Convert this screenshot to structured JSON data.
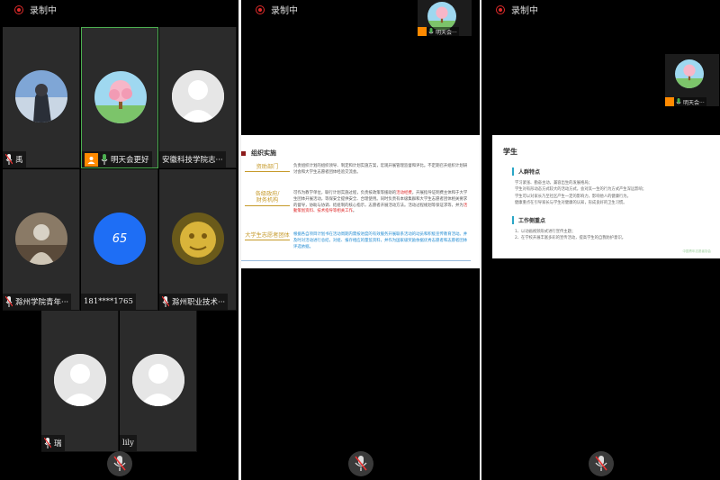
{
  "recording": {
    "label": "录制中"
  },
  "gallery": {
    "tiles": [
      {
        "name": "禹",
        "mic": "muted",
        "avatar": "photo-person"
      },
      {
        "name": "明天会更好",
        "mic": "active",
        "host": true,
        "avatar": "tree-illustration"
      },
      {
        "name": "安徽科技学院志···",
        "mic": "none",
        "avatar": "default"
      },
      {
        "name": "滁州学院青年···",
        "mic": "muted",
        "avatar": "photo-soldier"
      },
      {
        "name": "181****1765",
        "mic": "none",
        "avatar": "number",
        "avatar_text": "65"
      },
      {
        "name": "滁州职业技术···",
        "mic": "muted",
        "avatar": "golden-statue"
      },
      {
        "name": "瑞",
        "mic": "muted",
        "avatar": "default"
      },
      {
        "name": "lily",
        "mic": "none",
        "avatar": "default"
      }
    ]
  },
  "mini_video": {
    "label": "明天会···"
  },
  "slide_org": {
    "title": "组织实施",
    "rows": [
      {
        "key": "资助部门",
        "value": "负责组织计划的组织领导、制定和计划实施方案，宏观开展管理监督和评比。不定期召开组织计划研讨会和大学生志愿者团体经验交流会。"
      },
      {
        "key": "各级政府/\n财务机构",
        "value_a": "可作为教学单位，联行计划实施过程，负责按政策等援助的",
        "value_red": "活动经费",
        "value_b": "，开展指导证明费主体和于大学生团体开展活动，等保安全提供安全、合理使用。同时负责有本级集群和大学生志愿者团体相关要求的督导，协助与协调、结组制的核心指示，志愿者开展活动方法。活动过程规划等保证求等，并为",
        "value_red2": "活動策划资料、技术指导等相关工作",
        "value_c": "。"
      },
      {
        "key": "大学生志愿者团体",
        "value": "根据各自项目计划书在活动周期内需按进度的有效服务开展联系活动的动员和积极宣传教育活动。并及时对活动进行总结，对组、报存相应的量监资料，并作为国家级奖励依据优秀志愿者和志愿者团体评选依据。"
      }
    ]
  },
  "slide_student": {
    "title": "学生",
    "section1": "人群特点",
    "items1": [
      "学习紧张、勤奋主动，兼容出生的发展格局；",
      "学生对有形动态方式较大的活动方式，会对其一生的行为方式产生深远影响；",
      "学生可以对家长乃至社区产生一定的影响力，影响他人的健康行为。",
      "健康重点在引导家长与学生对健康的认知，形成良好的卫生习惯。"
    ],
    "section2": "工作侧重点",
    "items2": [
      "1、以动画视频形式进行宣传主题；",
      "2、在学校开展丰富多彩的宣传活动，提高学生的自我防护意识。"
    ],
    "footer": "中国青年志愿者协会"
  },
  "colors": {
    "recording": "#e02b2b",
    "active_border": "#4caf50",
    "host_badge": "#ff8a00",
    "number_avatar": "#1e6ef5"
  }
}
